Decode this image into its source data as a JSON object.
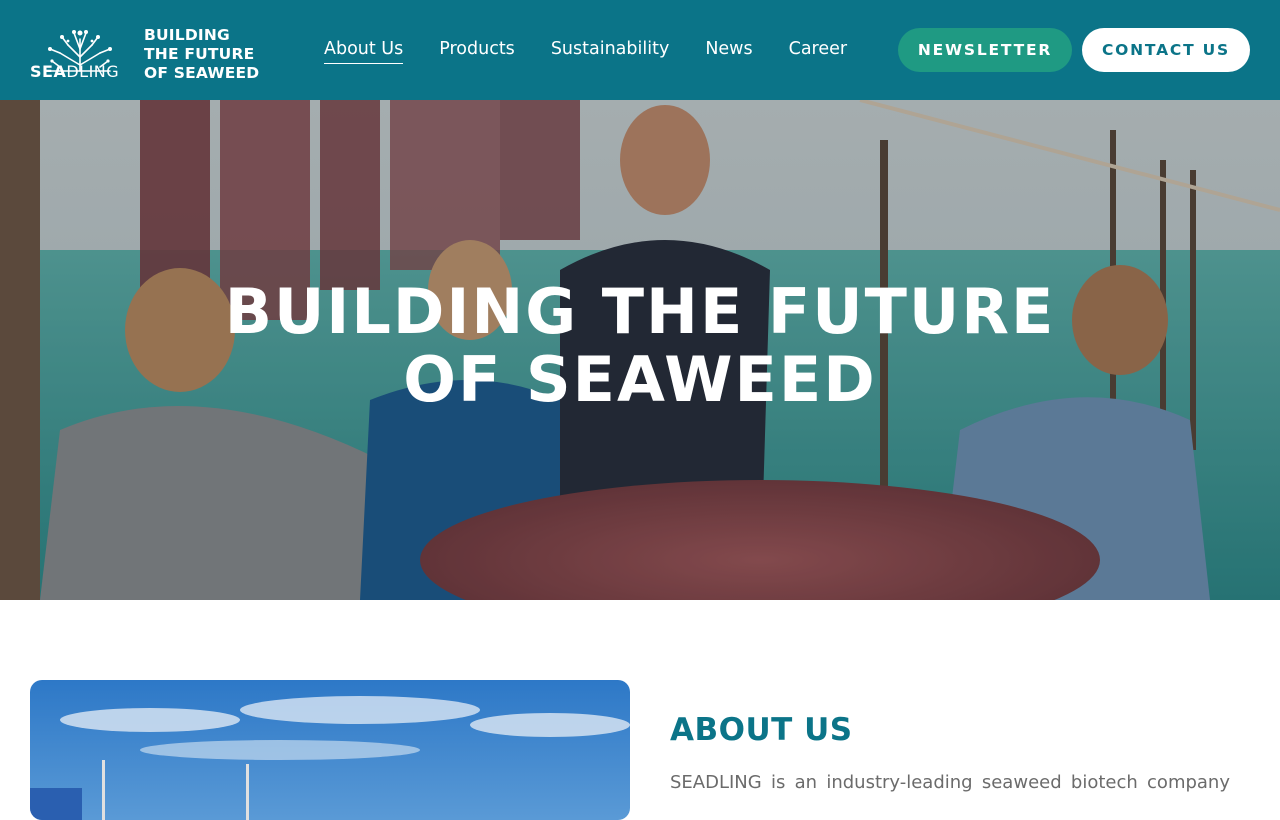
{
  "brand": {
    "name_part_bold": "SEA",
    "name_part_light": "DLING",
    "tagline_line1": "BUILDING",
    "tagline_line2": "THE FUTURE",
    "tagline_line3": "OF SEAWEED"
  },
  "nav": {
    "items": [
      {
        "label": "About Us",
        "active": true
      },
      {
        "label": "Products",
        "active": false
      },
      {
        "label": "Sustainability",
        "active": false
      },
      {
        "label": "News",
        "active": false
      },
      {
        "label": "Career",
        "active": false
      }
    ],
    "newsletter_label": "NEWSLETTER",
    "contact_label": "CONTACT US"
  },
  "hero": {
    "title_line1": "BUILDING THE FUTURE",
    "title_line2": "OF SEAWEED"
  },
  "about": {
    "heading": "ABOUT US",
    "text": "SEADLING is an industry-leading seaweed biotech company"
  },
  "colors": {
    "header_bg": "#0b7488",
    "newsletter_bg": "#1f9a83",
    "contact_text": "#0b7488",
    "heading_teal": "#0b7488"
  }
}
